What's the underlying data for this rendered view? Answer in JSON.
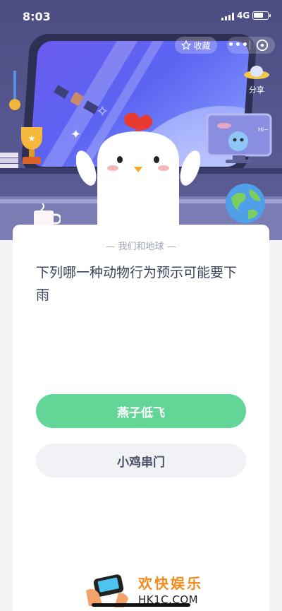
{
  "status_bar": {
    "time": "8:03",
    "network": "4G"
  },
  "top_actions": {
    "favorite_label": "收藏",
    "share_label": "分享"
  },
  "scene": {
    "screen_text": "Hi~"
  },
  "quiz": {
    "category": "我们和地球",
    "question": "下列哪一种动物行为预示可能要下雨",
    "options": [
      "燕子低飞",
      "小鸡串门"
    ]
  },
  "watermark": {
    "title": "欢快娱乐",
    "subtitle": "HK1C.COM"
  },
  "colors": {
    "scene_bg": "#4b4d83",
    "correct_option": "#63d596",
    "option_bg": "#f1f2f5",
    "watermark": "#f28a1c"
  },
  "icons": [
    "star-outline-icon",
    "more-dots-icon",
    "close-circle-icon",
    "ufo-share-icon",
    "signal-icon",
    "battery-icon"
  ]
}
